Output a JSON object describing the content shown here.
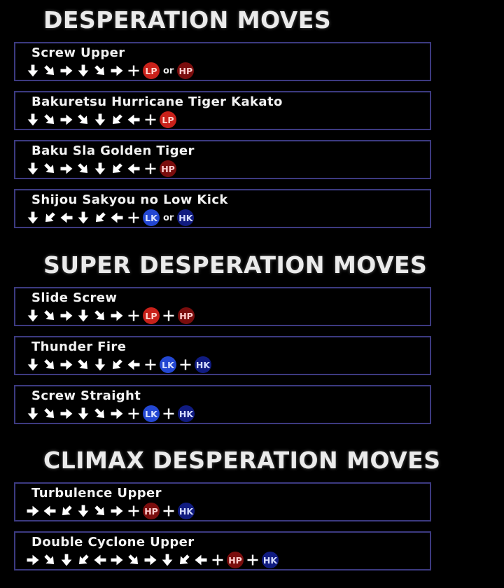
{
  "sections": [
    {
      "title": "DESPERATION MOVES",
      "moves": [
        {
          "name": "Screw Upper",
          "input": [
            "down",
            "down-right",
            "right",
            "down",
            "down-right",
            "right",
            "plus",
            "btn:LP",
            "or",
            "btn:HP"
          ]
        },
        {
          "name": "Bakuretsu Hurricane Tiger Kakato",
          "input": [
            "down",
            "down-right",
            "right",
            "down-right",
            "down",
            "down-left",
            "left",
            "plus",
            "btn:LP"
          ]
        },
        {
          "name": "Baku Sla Golden Tiger",
          "input": [
            "down",
            "down-right",
            "right",
            "down-right",
            "down",
            "down-left",
            "left",
            "plus",
            "btn:HP"
          ]
        },
        {
          "name": "Shijou Sakyou no Low Kick",
          "input": [
            "down",
            "down-left",
            "left",
            "down",
            "down-left",
            "left",
            "plus",
            "btn:LK",
            "or",
            "btn:HK"
          ]
        }
      ]
    },
    {
      "title": "SUPER DESPERATION MOVES",
      "moves": [
        {
          "name": "Slide Screw",
          "input": [
            "down",
            "down-right",
            "right",
            "down",
            "down-right",
            "right",
            "plus",
            "btn:LP",
            "plus",
            "btn:HP"
          ]
        },
        {
          "name": "Thunder Fire",
          "input": [
            "down",
            "down-right",
            "right",
            "down-right",
            "down",
            "down-left",
            "left",
            "plus",
            "btn:LK",
            "plus",
            "btn:HK"
          ]
        },
        {
          "name": "Screw Straight",
          "input": [
            "down",
            "down-right",
            "right",
            "down",
            "down-right",
            "right",
            "plus",
            "btn:LK",
            "plus",
            "btn:HK"
          ]
        }
      ]
    },
    {
      "title": "CLIMAX DESPERATION MOVES",
      "moves": [
        {
          "name": "Turbulence Upper",
          "input": [
            "right",
            "left",
            "down-left",
            "down",
            "down-right",
            "right",
            "plus",
            "btn:HP",
            "plus",
            "btn:HK"
          ]
        },
        {
          "name": "Double Cyclone Upper",
          "input": [
            "right",
            "down-right",
            "down",
            "down-left",
            "left",
            "right",
            "down-right",
            "right",
            "down",
            "down-left",
            "left",
            "plus",
            "btn:HP",
            "plus",
            "btn:HK"
          ]
        }
      ]
    }
  ],
  "labels": {
    "or": "or"
  },
  "buttons": {
    "LP": {
      "label": "LP",
      "bg": "#c8211a",
      "text": "#ffd7d0"
    },
    "HP": {
      "label": "HP",
      "bg": "#7a0d0d",
      "text": "#ffd0d0"
    },
    "LK": {
      "label": "LK",
      "bg": "#2347d2",
      "text": "#d9e2ff"
    },
    "HK": {
      "label": "HK",
      "bg": "#101b80",
      "text": "#d6ddff"
    }
  },
  "colors": {
    "background": "#000000",
    "box_border": "#3c3a80",
    "text": "#f2f2f2"
  }
}
